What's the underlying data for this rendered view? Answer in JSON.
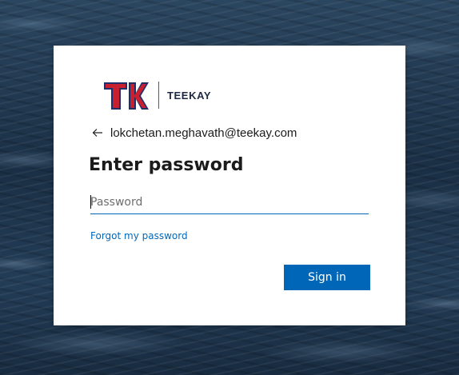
{
  "brand": {
    "name": "TEEKAY",
    "mark_icon": "teekay-tk-logo",
    "colors": {
      "mark_red": "#c8202f",
      "mark_navy": "#1e2f6b"
    }
  },
  "identity": {
    "back_icon": "back-arrow-icon",
    "email": "lokchetan.meghavath@teekay.com"
  },
  "title": "Enter password",
  "password": {
    "placeholder": "Password",
    "value": ""
  },
  "links": {
    "forgot_password": "Forgot my password"
  },
  "actions": {
    "sign_in": "Sign in"
  },
  "colors": {
    "accent": "#0067b8",
    "card_background": "#ffffff"
  }
}
